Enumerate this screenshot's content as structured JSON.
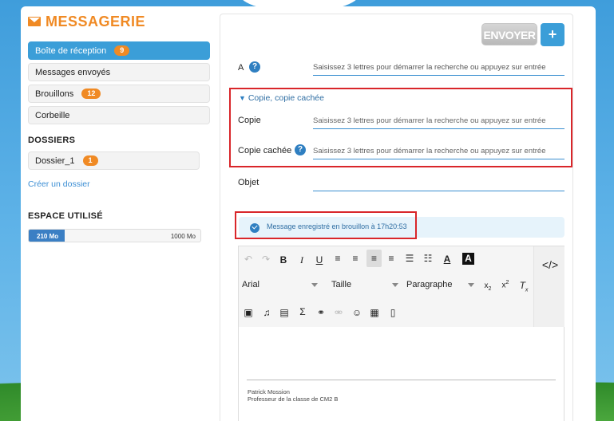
{
  "app": {
    "title": "MESSAGERIE"
  },
  "sidebar": {
    "folders": [
      {
        "label": "Boîte de réception",
        "badge": "9",
        "active": true
      },
      {
        "label": "Messages envoyés",
        "badge": ""
      },
      {
        "label": "Brouillons",
        "badge": "12"
      },
      {
        "label": "Corbeille",
        "badge": ""
      }
    ],
    "dossiers_title": "DOSSIERS",
    "dossiers": [
      {
        "label": "Dossier_1",
        "badge": "1"
      }
    ],
    "create_folder": "Créer un dossier",
    "storage_title": "ESPACE UTILISÉ",
    "storage_used": "210 Mo",
    "storage_total": "1000 Mo",
    "storage_fraction": 0.21
  },
  "compose": {
    "send_label": "ENVOYER",
    "add_label": "+",
    "to_label": "A",
    "to_placeholder": "Saisissez 3 lettres pour démarrer la recherche ou appuyez sur entrée",
    "cc_toggle": "Copie, copie cachée",
    "cc_label": "Copie",
    "cc_placeholder": "Saisissez 3 lettres pour démarrer la recherche ou appuyez sur entrée",
    "bcc_label": "Copie cachée",
    "bcc_placeholder": "Saisissez 3 lettres pour démarrer la recherche ou appuyez sur entrée",
    "subject_label": "Objet",
    "subject_value": "",
    "saved_notice": "Message enregistré en brouillon à 17h20:53"
  },
  "editor": {
    "font": "Arial",
    "size": "Taille",
    "format": "Paragraphe",
    "signature_name": "Patrick Mossion",
    "signature_title": "Professeur de la classe de CM2 B"
  },
  "colors": {
    "accent": "#3b9ed8",
    "brand": "#f08a24",
    "highlight_frame": "#d9262a"
  }
}
